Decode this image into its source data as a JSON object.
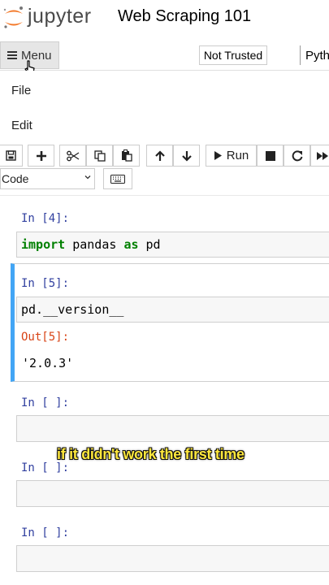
{
  "app": {
    "logo_text": "jupyter",
    "notebook_title": "Web Scraping 101"
  },
  "menubar": {
    "menu_label": "Menu",
    "trust_label": "Not Trusted",
    "kernel_label": "Pyth"
  },
  "dropdown": {
    "items": [
      "File",
      "Edit"
    ]
  },
  "toolbar": {
    "run_label": "Run",
    "cell_type": "Code",
    "icons": [
      "save-icon",
      "add-icon",
      "cut-icon",
      "copy-icon",
      "paste-icon",
      "move-up-icon",
      "move-down-icon",
      "run-icon",
      "stop-icon",
      "restart-icon",
      "fast-forward-icon",
      "keyboard-icon"
    ]
  },
  "cells": [
    {
      "prompt": "In [4]:",
      "code_keyword1": "import",
      "code_mid": " pandas ",
      "code_keyword2": "as",
      "code_end": " pd"
    },
    {
      "prompt": "In [5]:",
      "code": "pd.__version__",
      "out_prompt": "Out[5]:",
      "output": "'2.0.3'"
    },
    {
      "prompt": "In [ ]:"
    },
    {
      "prompt": "In [ ]:"
    },
    {
      "prompt": "In [ ]:"
    }
  ],
  "caption": "if it didn't work the first time",
  "colors": {
    "selected_border": "#42a5f5",
    "in_prompt": "#303f9f",
    "out_prompt": "#d84315",
    "keyword": "#008000",
    "caption": "#ffe83d"
  }
}
